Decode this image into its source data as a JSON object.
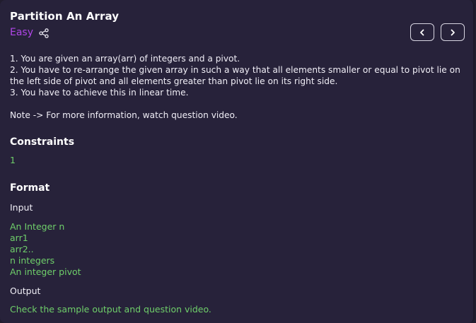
{
  "problem": {
    "title": "Partition An Array",
    "difficulty": "Easy",
    "share_icon": "share-icon",
    "prev_icon": "chevron-left-icon",
    "next_icon": "chevron-right-icon",
    "description_lines": [
      "1. You are given an array(arr) of integers and a pivot.",
      "2. You have to re-arrange the given array in such a way that all elements smaller or equal to pivot lie on the left side of pivot and all elements greater than pivot lie on its right side.",
      "3. You have to achieve this in linear time."
    ],
    "note": "Note -> For more information, watch question video."
  },
  "constraints": {
    "heading": "Constraints",
    "value": "1"
  },
  "format": {
    "heading": "Format",
    "input_label": "Input",
    "input_lines": [
      "An Integer n",
      "arr1",
      "arr2..",
      "n integers",
      "An integer pivot"
    ],
    "output_label": "Output",
    "output_text": "Check the sample output and question video."
  },
  "colors": {
    "background": "#27223a",
    "difficulty": "#b046e8",
    "green_text": "#6fcf6a"
  }
}
